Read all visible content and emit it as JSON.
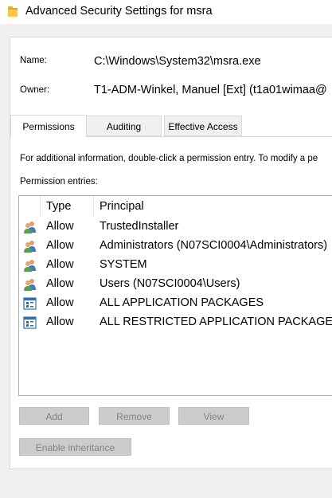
{
  "window": {
    "title": "Advanced Security Settings for msra"
  },
  "fields": {
    "name_label": "Name:",
    "name_value": "C:\\Windows\\System32\\msra.exe",
    "owner_label": "Owner:",
    "owner_value": "T1-ADM-Winkel, Manuel [Ext] (t1a01wimaa@"
  },
  "tabs": [
    {
      "label": "Permissions",
      "active": true
    },
    {
      "label": "Auditing",
      "active": false
    },
    {
      "label": "Effective Access",
      "active": false
    }
  ],
  "permissions": {
    "info_text": "For additional information, double-click a permission entry. To modify a pe",
    "entries_label": "Permission entries:",
    "columns": {
      "type": "Type",
      "principal": "Principal"
    },
    "rows": [
      {
        "type": "Allow",
        "principal": "TrustedInstaller",
        "icon": "users-icon"
      },
      {
        "type": "Allow",
        "principal": "Administrators (N07SCI0004\\Administrators)",
        "icon": "users-icon"
      },
      {
        "type": "Allow",
        "principal": "SYSTEM",
        "icon": "users-icon"
      },
      {
        "type": "Allow",
        "principal": "Users (N07SCI0004\\Users)",
        "icon": "users-icon"
      },
      {
        "type": "Allow",
        "principal": "ALL APPLICATION PACKAGES",
        "icon": "app-package-icon"
      },
      {
        "type": "Allow",
        "principal": "ALL RESTRICTED APPLICATION PACKAGES",
        "icon": "app-package-icon"
      }
    ]
  },
  "buttons": {
    "add": "Add",
    "remove": "Remove",
    "view": "View",
    "enable_inheritance": "Enable inheritance"
  },
  "colors": {
    "window_bg": "#f0f0f0",
    "panel_bg": "#ffffff",
    "disabled_button": "#cccccc",
    "disabled_text": "#838383"
  }
}
